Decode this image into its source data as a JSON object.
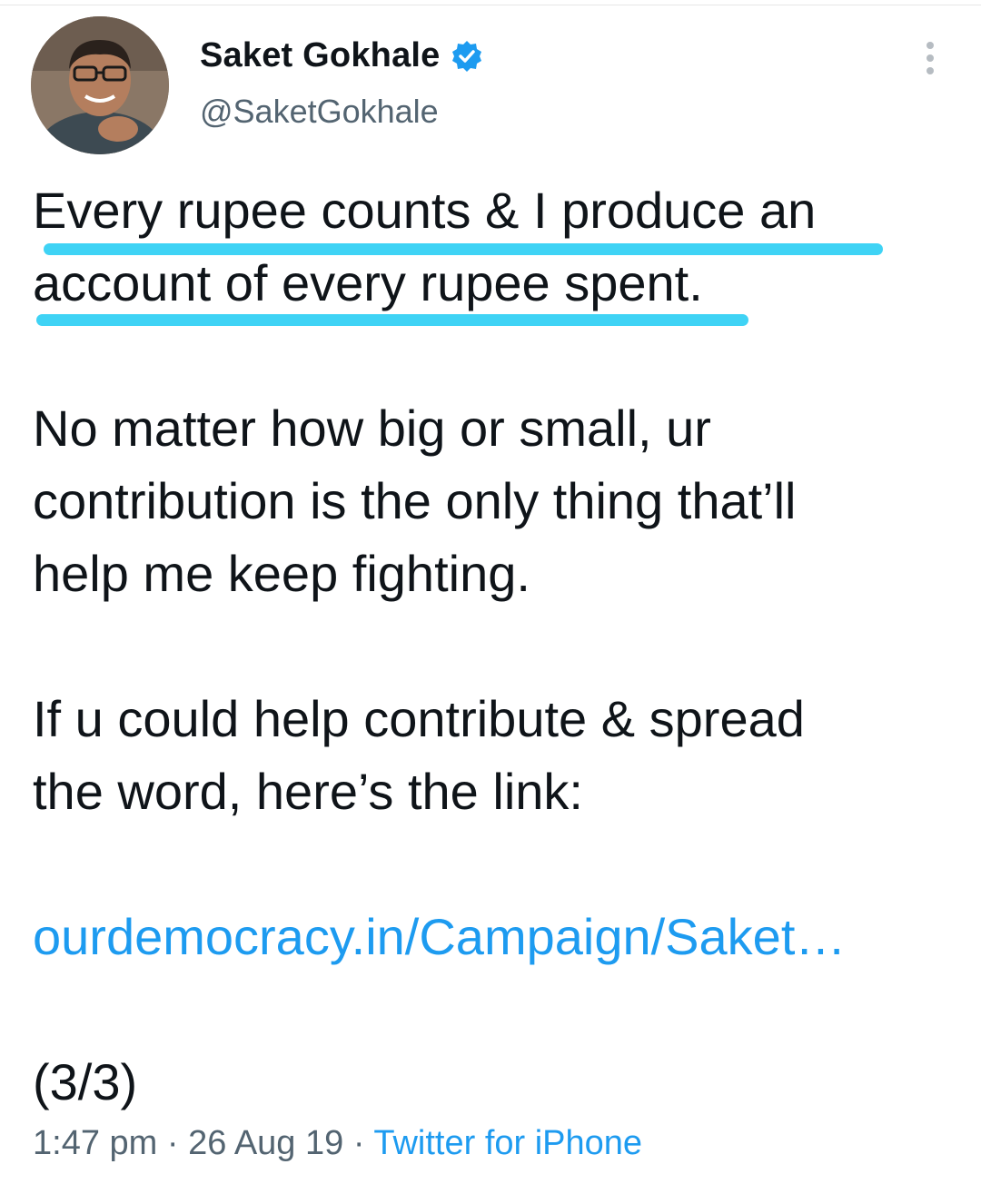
{
  "author": {
    "name": "Saket Gokhale",
    "handle": "@SaketGokhale",
    "verified": true,
    "avatar_icon": "profile-photo"
  },
  "tweet": {
    "line1": "Every rupee counts & I produce an",
    "line2": "account of every rupee spent.",
    "para2_line1": "No matter how big or small, ur",
    "para2_line2": "contribution is the only thing that’ll",
    "para2_line3": "help me keep fighting.",
    "para3_line1": "If u could help contribute & spread",
    "para3_line2": "the word, here’s the link:",
    "link": "ourdemocracy.in/Campaign/Saket…",
    "thread_count": "(3/3)"
  },
  "meta": {
    "time": "1:47 pm",
    "separator": " · ",
    "date": "26 Aug 19",
    "source": "Twitter for iPhone"
  },
  "colors": {
    "link": "#1d9bf0",
    "highlight": "#3fd3f5",
    "verified": "#1d9bf0",
    "secondary_text": "#536471"
  },
  "icons": {
    "more": "more-vertical-icon",
    "verified": "verified-badge-icon"
  }
}
